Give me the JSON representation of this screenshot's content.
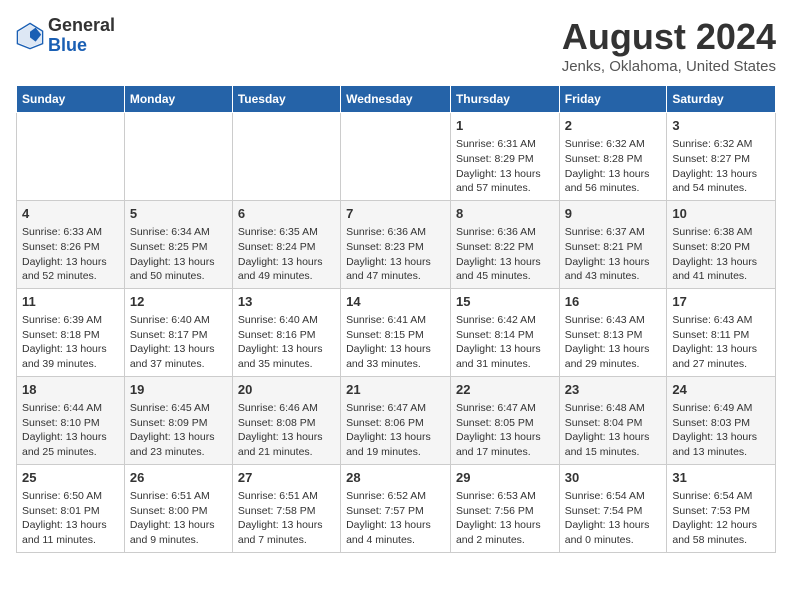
{
  "header": {
    "logo_general": "General",
    "logo_blue": "Blue",
    "month_year": "August 2024",
    "location": "Jenks, Oklahoma, United States"
  },
  "days_of_week": [
    "Sunday",
    "Monday",
    "Tuesday",
    "Wednesday",
    "Thursday",
    "Friday",
    "Saturday"
  ],
  "weeks": [
    [
      {
        "day": "",
        "info": ""
      },
      {
        "day": "",
        "info": ""
      },
      {
        "day": "",
        "info": ""
      },
      {
        "day": "",
        "info": ""
      },
      {
        "day": "1",
        "info": "Sunrise: 6:31 AM\nSunset: 8:29 PM\nDaylight: 13 hours\nand 57 minutes."
      },
      {
        "day": "2",
        "info": "Sunrise: 6:32 AM\nSunset: 8:28 PM\nDaylight: 13 hours\nand 56 minutes."
      },
      {
        "day": "3",
        "info": "Sunrise: 6:32 AM\nSunset: 8:27 PM\nDaylight: 13 hours\nand 54 minutes."
      }
    ],
    [
      {
        "day": "4",
        "info": "Sunrise: 6:33 AM\nSunset: 8:26 PM\nDaylight: 13 hours\nand 52 minutes."
      },
      {
        "day": "5",
        "info": "Sunrise: 6:34 AM\nSunset: 8:25 PM\nDaylight: 13 hours\nand 50 minutes."
      },
      {
        "day": "6",
        "info": "Sunrise: 6:35 AM\nSunset: 8:24 PM\nDaylight: 13 hours\nand 49 minutes."
      },
      {
        "day": "7",
        "info": "Sunrise: 6:36 AM\nSunset: 8:23 PM\nDaylight: 13 hours\nand 47 minutes."
      },
      {
        "day": "8",
        "info": "Sunrise: 6:36 AM\nSunset: 8:22 PM\nDaylight: 13 hours\nand 45 minutes."
      },
      {
        "day": "9",
        "info": "Sunrise: 6:37 AM\nSunset: 8:21 PM\nDaylight: 13 hours\nand 43 minutes."
      },
      {
        "day": "10",
        "info": "Sunrise: 6:38 AM\nSunset: 8:20 PM\nDaylight: 13 hours\nand 41 minutes."
      }
    ],
    [
      {
        "day": "11",
        "info": "Sunrise: 6:39 AM\nSunset: 8:18 PM\nDaylight: 13 hours\nand 39 minutes."
      },
      {
        "day": "12",
        "info": "Sunrise: 6:40 AM\nSunset: 8:17 PM\nDaylight: 13 hours\nand 37 minutes."
      },
      {
        "day": "13",
        "info": "Sunrise: 6:40 AM\nSunset: 8:16 PM\nDaylight: 13 hours\nand 35 minutes."
      },
      {
        "day": "14",
        "info": "Sunrise: 6:41 AM\nSunset: 8:15 PM\nDaylight: 13 hours\nand 33 minutes."
      },
      {
        "day": "15",
        "info": "Sunrise: 6:42 AM\nSunset: 8:14 PM\nDaylight: 13 hours\nand 31 minutes."
      },
      {
        "day": "16",
        "info": "Sunrise: 6:43 AM\nSunset: 8:13 PM\nDaylight: 13 hours\nand 29 minutes."
      },
      {
        "day": "17",
        "info": "Sunrise: 6:43 AM\nSunset: 8:11 PM\nDaylight: 13 hours\nand 27 minutes."
      }
    ],
    [
      {
        "day": "18",
        "info": "Sunrise: 6:44 AM\nSunset: 8:10 PM\nDaylight: 13 hours\nand 25 minutes."
      },
      {
        "day": "19",
        "info": "Sunrise: 6:45 AM\nSunset: 8:09 PM\nDaylight: 13 hours\nand 23 minutes."
      },
      {
        "day": "20",
        "info": "Sunrise: 6:46 AM\nSunset: 8:08 PM\nDaylight: 13 hours\nand 21 minutes."
      },
      {
        "day": "21",
        "info": "Sunrise: 6:47 AM\nSunset: 8:06 PM\nDaylight: 13 hours\nand 19 minutes."
      },
      {
        "day": "22",
        "info": "Sunrise: 6:47 AM\nSunset: 8:05 PM\nDaylight: 13 hours\nand 17 minutes."
      },
      {
        "day": "23",
        "info": "Sunrise: 6:48 AM\nSunset: 8:04 PM\nDaylight: 13 hours\nand 15 minutes."
      },
      {
        "day": "24",
        "info": "Sunrise: 6:49 AM\nSunset: 8:03 PM\nDaylight: 13 hours\nand 13 minutes."
      }
    ],
    [
      {
        "day": "25",
        "info": "Sunrise: 6:50 AM\nSunset: 8:01 PM\nDaylight: 13 hours\nand 11 minutes."
      },
      {
        "day": "26",
        "info": "Sunrise: 6:51 AM\nSunset: 8:00 PM\nDaylight: 13 hours\nand 9 minutes."
      },
      {
        "day": "27",
        "info": "Sunrise: 6:51 AM\nSunset: 7:58 PM\nDaylight: 13 hours\nand 7 minutes."
      },
      {
        "day": "28",
        "info": "Sunrise: 6:52 AM\nSunset: 7:57 PM\nDaylight: 13 hours\nand 4 minutes."
      },
      {
        "day": "29",
        "info": "Sunrise: 6:53 AM\nSunset: 7:56 PM\nDaylight: 13 hours\nand 2 minutes."
      },
      {
        "day": "30",
        "info": "Sunrise: 6:54 AM\nSunset: 7:54 PM\nDaylight: 13 hours\nand 0 minutes."
      },
      {
        "day": "31",
        "info": "Sunrise: 6:54 AM\nSunset: 7:53 PM\nDaylight: 12 hours\nand 58 minutes."
      }
    ]
  ]
}
